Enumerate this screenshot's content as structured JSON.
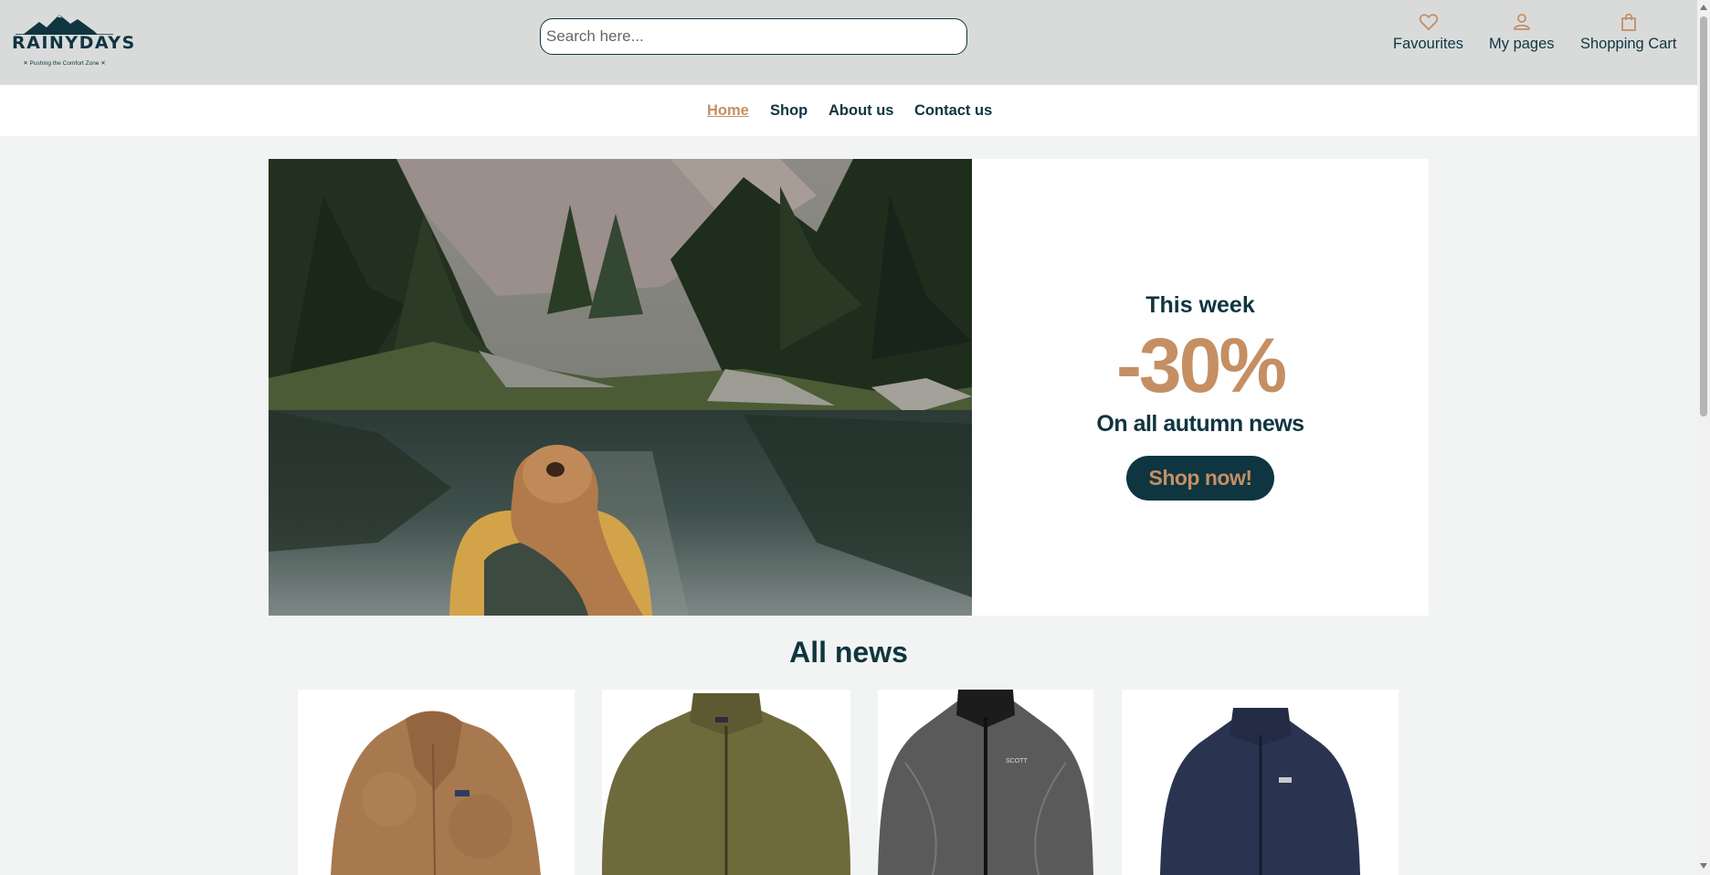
{
  "header": {
    "logo_text": "RAINYDAYS",
    "logo_tagline": "✕ Pushing the Comfort Zone ✕",
    "search_placeholder": "Search here...",
    "links": [
      {
        "label": "Favourites",
        "icon": "heart-icon"
      },
      {
        "label": "My pages",
        "icon": "user-icon"
      },
      {
        "label": "Shopping Cart",
        "icon": "shopping-bag-icon"
      }
    ]
  },
  "nav": {
    "items": [
      {
        "label": "Home",
        "active": true
      },
      {
        "label": "Shop"
      },
      {
        "label": "About us"
      },
      {
        "label": "Contact us"
      }
    ]
  },
  "hero": {
    "week": "This week",
    "discount": "-30%",
    "subtitle": "On all autumn news",
    "button": "Shop now!"
  },
  "news": {
    "title": "All news",
    "products": [
      {
        "name": "teddy-jacket"
      },
      {
        "name": "olive-fleece-jacket"
      },
      {
        "name": "grey-windbreaker-jacket"
      },
      {
        "name": "navy-fleece-jacket"
      }
    ]
  },
  "colors": {
    "primary": "#0f3540",
    "accent": "#c58f63",
    "header_bg": "#d9dbdb",
    "page_bg": "#f2f4f3"
  }
}
